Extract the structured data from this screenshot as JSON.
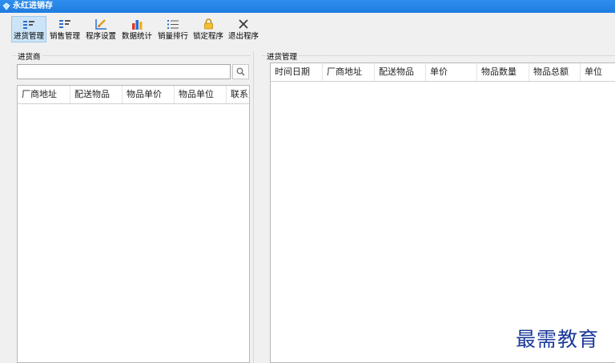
{
  "window": {
    "title": "永红进销存"
  },
  "toolbar": {
    "items": [
      {
        "label": "进货管理",
        "icon": "list-icon",
        "active": true
      },
      {
        "label": "销售管理",
        "icon": "list-icon",
        "active": false
      },
      {
        "label": "程序设置",
        "icon": "pencil-chart-icon",
        "active": false
      },
      {
        "label": "数据统计",
        "icon": "bar-chart-icon",
        "active": false
      },
      {
        "label": "销量排行",
        "icon": "ranking-list-icon",
        "active": false
      },
      {
        "label": "锁定程序",
        "icon": "lock-icon",
        "active": false
      },
      {
        "label": "退出程序",
        "icon": "close-icon",
        "active": false
      }
    ]
  },
  "supplier_panel": {
    "title": "进货商",
    "search": {
      "value": "",
      "placeholder": ""
    },
    "columns": [
      "厂商地址",
      "配送物品",
      "物品单价",
      "物品单位",
      "联系方式"
    ]
  },
  "purchase_panel": {
    "title": "进货管理",
    "columns": [
      "时间日期",
      "厂商地址",
      "配送物品",
      "单价",
      "物品数量",
      "物品总额",
      "单位"
    ]
  },
  "watermark": "最需教育",
  "colors": {
    "titlebar": "#1f7ce0",
    "active_button": "#cce4f7"
  }
}
